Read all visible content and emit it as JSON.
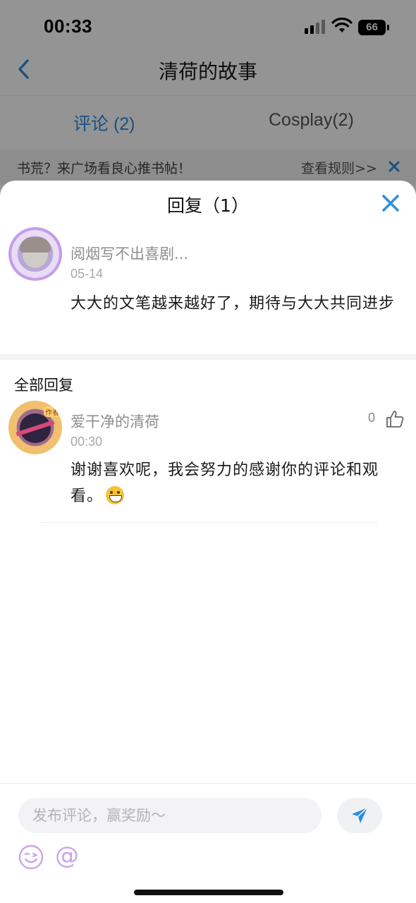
{
  "status_bar": {
    "time": "00:33",
    "battery": "66"
  },
  "nav": {
    "title": "清荷的故事"
  },
  "tabs": [
    {
      "label": "评论 (2)",
      "active": true
    },
    {
      "label": "Cosplay(2)",
      "active": false
    }
  ],
  "notice": {
    "text": "书荒？来广场看良心推书帖！",
    "link": "查看规则>>"
  },
  "sheet": {
    "title": "回复（1）",
    "original_comment": {
      "name": "阅烟写不出喜剧...",
      "date": "05-14",
      "text": "大大的文笔越来越好了，期待与大大共同进步"
    },
    "all_replies_label": "全部回复",
    "replies": [
      {
        "name": "爱干净的清荷",
        "date": "00:30",
        "text": "谢谢喜欢呢，我会努力的感谢你的评论和观看。",
        "emoji": "grinning-face",
        "likes": "0",
        "author_badge": "作者"
      }
    ]
  },
  "input_bar": {
    "placeholder": "发布评论，赢奖励～"
  },
  "colors": {
    "accent": "#2a8ce5",
    "close_blue": "#2f8fdf",
    "emoji_purple": "#c8a6e8"
  }
}
